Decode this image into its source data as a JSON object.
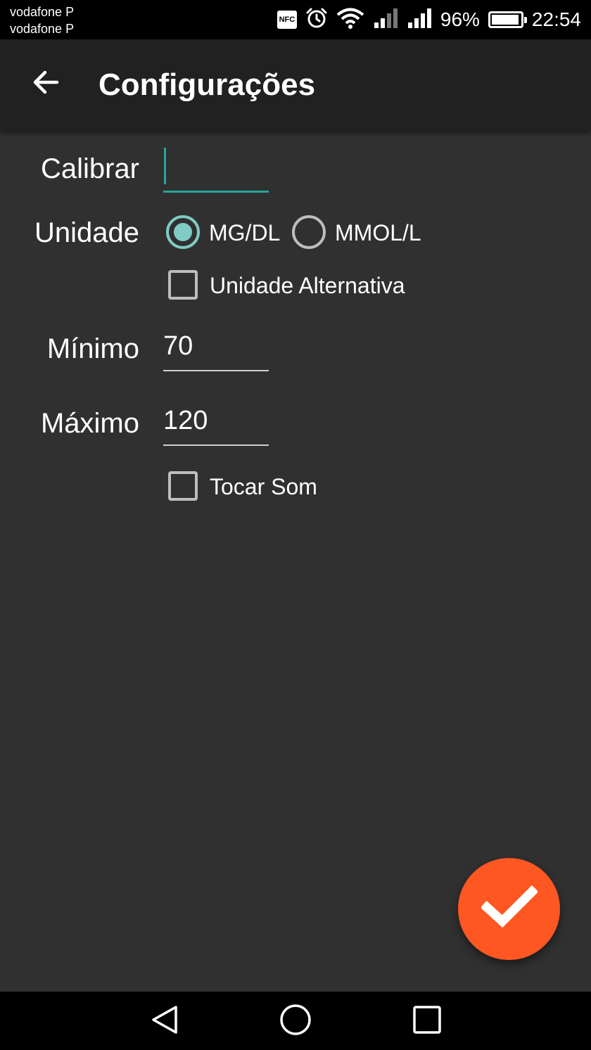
{
  "status_bar": {
    "carrier_1": "vodafone P",
    "carrier_2": "vodafone P",
    "nfc_label": "NFC",
    "battery_percent": "96%",
    "battery_level": 0.96,
    "time": "22:54",
    "icons": [
      "nfc-icon",
      "alarm-icon",
      "wifi-icon",
      "signal-icon",
      "signal-icon",
      "battery-icon"
    ]
  },
  "app_bar": {
    "title": "Configurações",
    "back_icon": "arrow-back-icon"
  },
  "form": {
    "calibrar": {
      "label": "Calibrar",
      "value": ""
    },
    "unidade": {
      "label": "Unidade",
      "options": [
        {
          "label": "MG/DL",
          "checked": true
        },
        {
          "label": "MMOL/L",
          "checked": false
        }
      ]
    },
    "alt_unit": {
      "label": "Unidade Alternativa",
      "checked": false
    },
    "minimo": {
      "label": "Mínimo",
      "value": "70"
    },
    "maximo": {
      "label": "Máximo",
      "value": "120"
    },
    "play_sound": {
      "label": "Tocar Som",
      "checked": false
    }
  },
  "fab": {
    "icon": "check-icon",
    "color": "#ff5722"
  },
  "nav_bar": {
    "icons": [
      "back-triangle-icon",
      "home-circle-icon",
      "recents-square-icon"
    ]
  },
  "colors": {
    "accent": "#26a69a",
    "radio_checked": "#80cbc4",
    "background": "#303030",
    "app_bar": "#212121"
  }
}
